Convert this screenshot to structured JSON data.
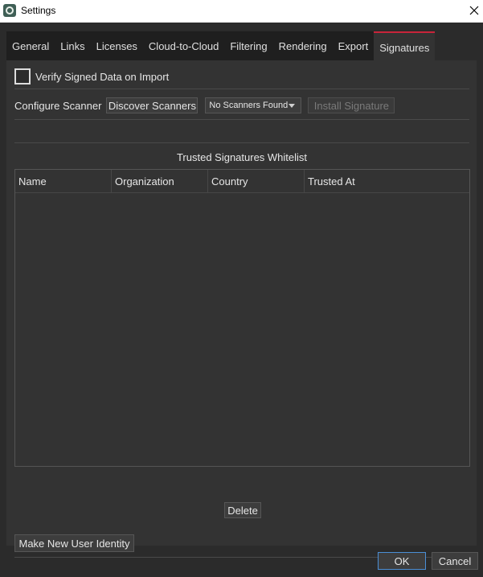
{
  "window": {
    "title": "Settings"
  },
  "tabs": [
    {
      "label": "General"
    },
    {
      "label": "Links"
    },
    {
      "label": "Licenses"
    },
    {
      "label": "Cloud-to-Cloud"
    },
    {
      "label": "Filtering"
    },
    {
      "label": "Rendering"
    },
    {
      "label": "Export"
    },
    {
      "label": "Signatures",
      "active": true
    }
  ],
  "signatures": {
    "verify_label": "Verify Signed Data on Import",
    "verify_checked": false,
    "configure_scanner_label": "Configure Scanner",
    "discover_scanners_label": "Discover Scanners",
    "scanner_selected": "No Scanners Found",
    "install_signature_label": "Install Signature",
    "whitelist_title": "Trusted Signatures Whitelist",
    "columns": [
      "Name",
      "Organization",
      "Country",
      "Trusted At"
    ],
    "rows": [],
    "delete_label": "Delete",
    "new_identity_label": "Make New User Identity"
  },
  "footer": {
    "ok_label": "OK",
    "cancel_label": "Cancel"
  },
  "colors": {
    "active_tab_accent": "#c8243a",
    "default_button_border": "#4b8fd6"
  }
}
